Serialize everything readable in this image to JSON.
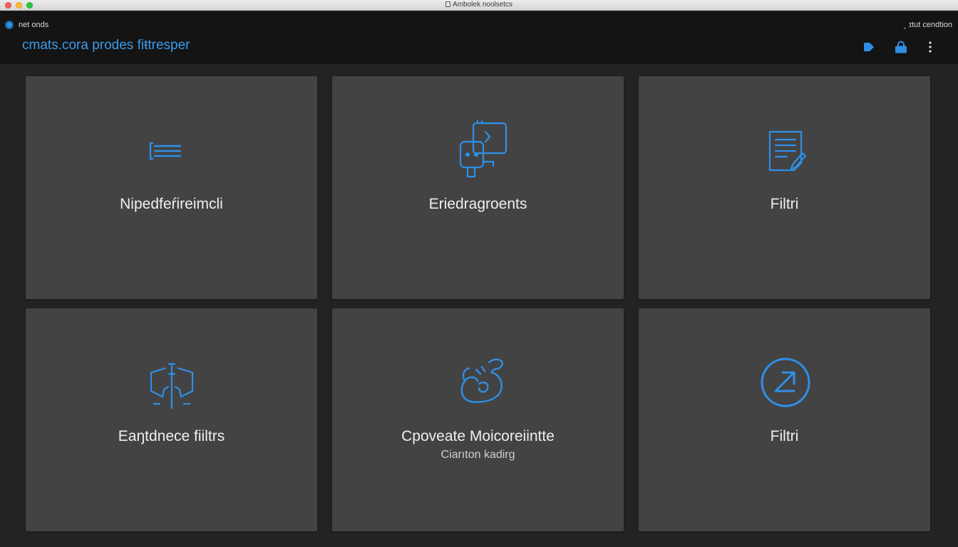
{
  "window": {
    "title": "Ambolek noolsetcs"
  },
  "appbar": {
    "app_name": "net onds",
    "heading": "cmats.cora prodes fiŧtresper",
    "status": "ɪtut cendtion",
    "buttons": [
      {
        "icon": "play-icon"
      },
      {
        "icon": "lock-icon"
      },
      {
        "icon": "more-vertical-icon"
      }
    ]
  },
  "cards": [
    {
      "label": "Nipedfeŕireimcli",
      "icon": "list-lines-icon"
    },
    {
      "label": "Eriedragroents",
      "icon": "chat-window-icon"
    },
    {
      "label": "Filtri",
      "icon": "document-edit-icon"
    },
    {
      "label": "Eaŋtdnece fiiltrs",
      "icon": "funnel-split-icon"
    },
    {
      "label": "Cpoveate Moicoreiintte",
      "sublabel": "Ciarıton kadirg",
      "icon": "bird-icon"
    },
    {
      "label": "Filtri",
      "icon": "arrow-circle-icon"
    }
  ],
  "colors": {
    "accent": "#3d9be9",
    "card": "#434343",
    "background": "#232323",
    "appbar": "#141414"
  }
}
